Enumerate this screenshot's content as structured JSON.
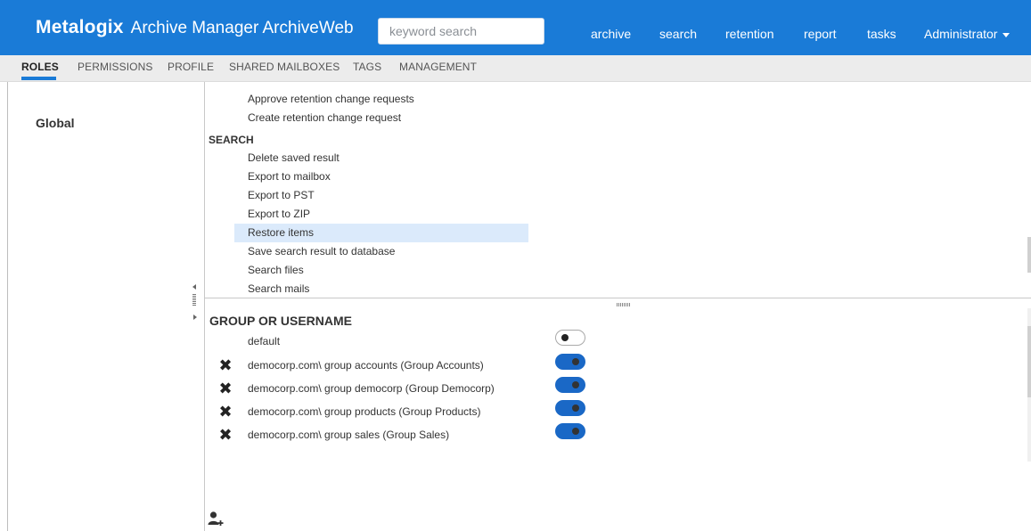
{
  "app": {
    "brand_logo": "Metalogix",
    "title": "Archive Manager ArchiveWeb"
  },
  "search": {
    "placeholder": "keyword search",
    "value": ""
  },
  "topnav": {
    "items": [
      "archive",
      "search",
      "retention",
      "report",
      "tasks"
    ],
    "user_menu": "Administrator"
  },
  "subnav": {
    "tabs": [
      "ROLES",
      "PERMISSIONS",
      "PROFILE",
      "SHARED MAILBOXES",
      "TAGS",
      "MANAGEMENT"
    ],
    "active": "ROLES"
  },
  "roles": {
    "selected": "Global"
  },
  "permissions": {
    "retention_items": [
      "Approve retention change requests",
      "Create retention change request"
    ],
    "search_heading": "SEARCH",
    "search_items": [
      "Delete saved result",
      "Export to mailbox",
      "Export to PST",
      "Export to ZIP",
      "Restore items",
      "Save search result to database",
      "Search files",
      "Search mails"
    ],
    "selected": "Restore items"
  },
  "assignments": {
    "heading": "GROUP OR USERNAME",
    "rows": [
      {
        "label": "default",
        "removable": false,
        "enabled": false
      },
      {
        "label": "democorp.com\\ group accounts (Group Accounts)",
        "removable": true,
        "enabled": true
      },
      {
        "label": "democorp.com\\ group democorp (Group Democorp)",
        "removable": true,
        "enabled": true
      },
      {
        "label": "democorp.com\\ group products (Group Products)",
        "removable": true,
        "enabled": true
      },
      {
        "label": "democorp.com\\ group sales (Group Sales)",
        "removable": true,
        "enabled": true
      }
    ],
    "remove_glyph": "✖"
  },
  "colors": {
    "accent": "#1a7bd7",
    "toggle_on": "#1a68c6",
    "selection": "#dbeafb"
  },
  "icons": {
    "remove": "close-icon",
    "add_user": "add-user-icon",
    "user_menu": "caret-down-icon"
  }
}
